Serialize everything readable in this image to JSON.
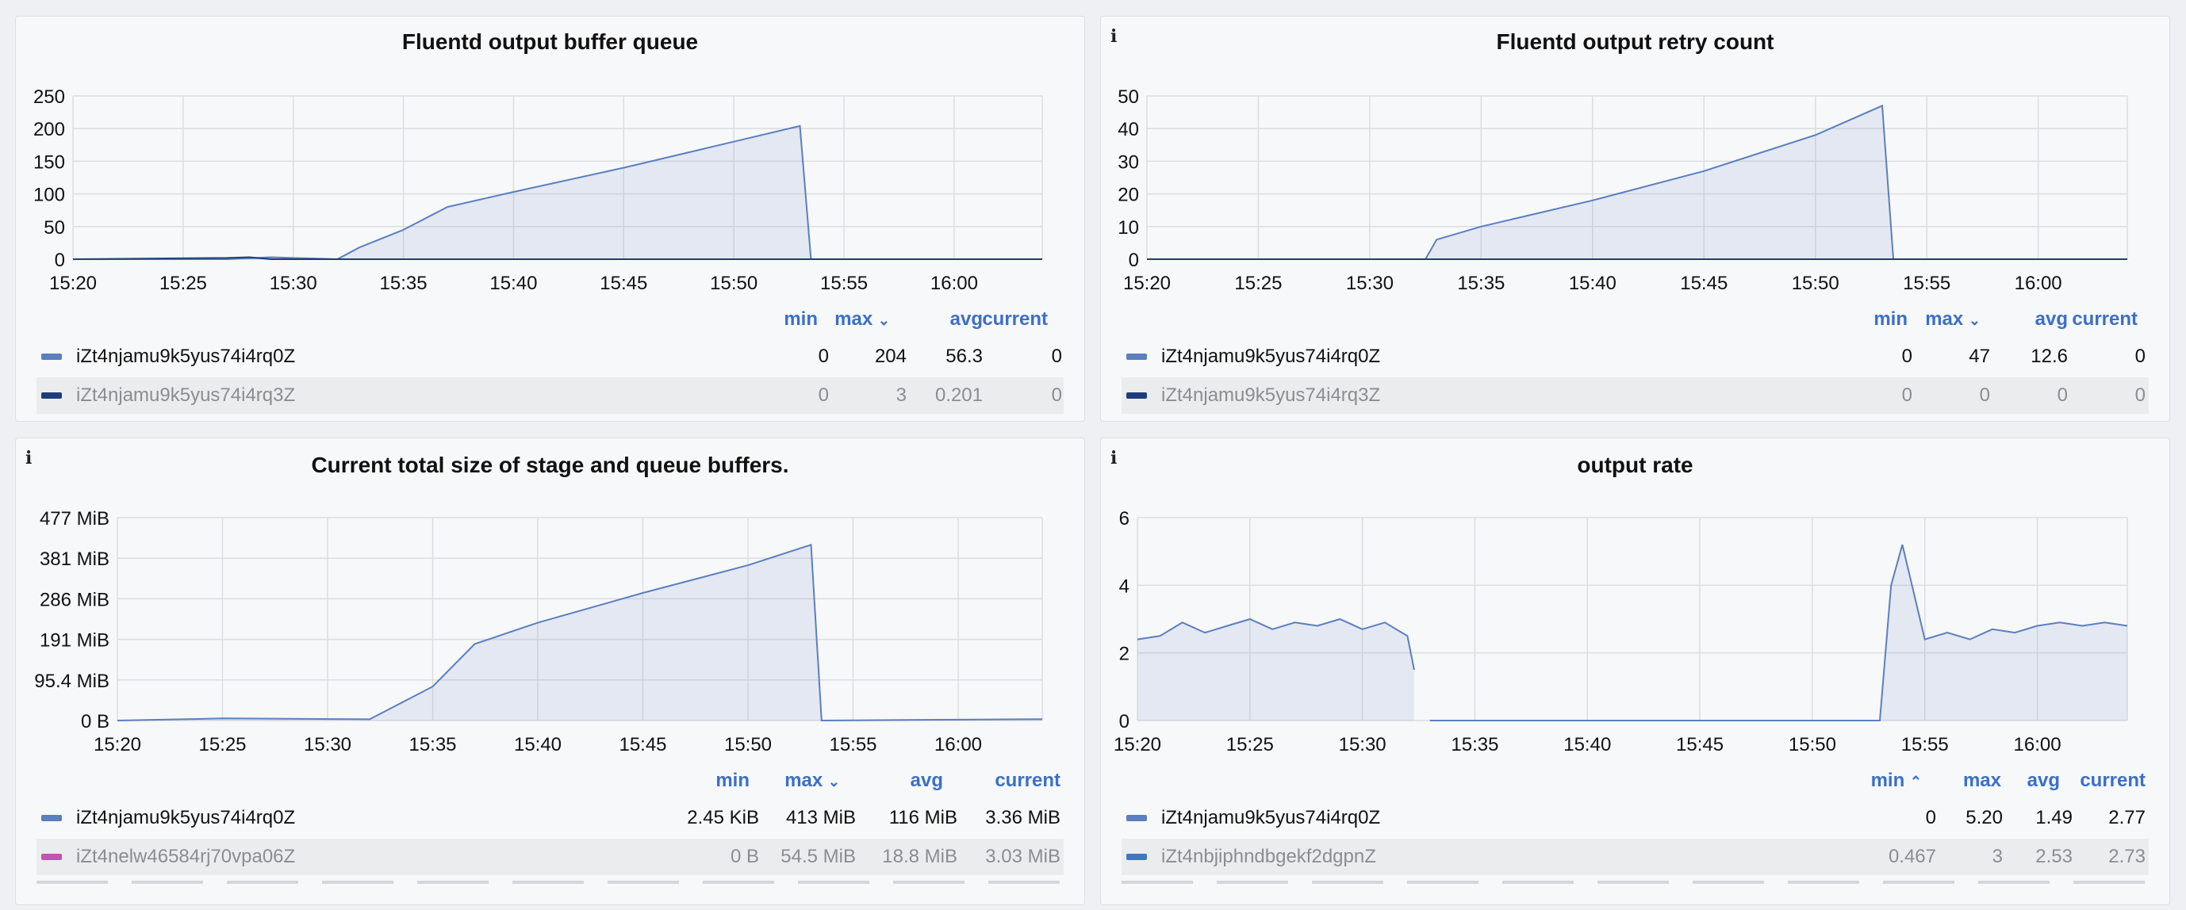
{
  "panels": [
    {
      "id": "p1",
      "title": "Fluentd output buffer queue",
      "show_info": false,
      "ylabels": [
        "250",
        "200",
        "150",
        "100",
        "50",
        "0"
      ],
      "xlabels": [
        "15:20",
        "15:25",
        "15:30",
        "15:35",
        "15:40",
        "15:45",
        "15:50",
        "15:55",
        "16:00"
      ],
      "legend_headers": {
        "min": "min",
        "max": "max",
        "avg": "avg",
        "current": "current",
        "sort": "max",
        "sort_dir": "down"
      },
      "legend": [
        {
          "name": "iZt4njamu9k5yus74i4rq0Z",
          "min": "0",
          "max": "204",
          "avg": "56.3",
          "current": "0",
          "color": "#5b7fbf"
        },
        {
          "name": "iZt4njamu9k5yus74i4rq3Z",
          "min": "0",
          "max": "3",
          "avg": "0.201",
          "current": "0",
          "color": "#1f3d7a"
        }
      ]
    },
    {
      "id": "p2",
      "title": "Fluentd output retry count",
      "show_info": true,
      "ylabels": [
        "50",
        "40",
        "30",
        "20",
        "10",
        "0"
      ],
      "xlabels": [
        "15:20",
        "15:25",
        "15:30",
        "15:35",
        "15:40",
        "15:45",
        "15:50",
        "15:55",
        "16:00"
      ],
      "legend_headers": {
        "min": "min",
        "max": "max",
        "avg": "avg",
        "current": "current",
        "sort": "max",
        "sort_dir": "down"
      },
      "legend": [
        {
          "name": "iZt4njamu9k5yus74i4rq0Z",
          "min": "0",
          "max": "47",
          "avg": "12.6",
          "current": "0",
          "color": "#5b7fbf"
        },
        {
          "name": "iZt4njamu9k5yus74i4rq3Z",
          "min": "0",
          "max": "0",
          "avg": "0",
          "current": "0",
          "color": "#1f3d7a"
        }
      ]
    },
    {
      "id": "p3",
      "title": "Current total size of stage and queue buffers.",
      "show_info": true,
      "ylabels": [
        "477 MiB",
        "381 MiB",
        "286 MiB",
        "191 MiB",
        "95.4 MiB",
        "0 B"
      ],
      "xlabels": [
        "15:20",
        "15:25",
        "15:30",
        "15:35",
        "15:40",
        "15:45",
        "15:50",
        "15:55",
        "16:00"
      ],
      "legend_headers": {
        "min": "min",
        "max": "max",
        "avg": "avg",
        "current": "current",
        "sort": "max",
        "sort_dir": "down"
      },
      "legend": [
        {
          "name": "iZt4njamu9k5yus74i4rq0Z",
          "min": "2.45 KiB",
          "max": "413 MiB",
          "avg": "116 MiB",
          "current": "3.36 MiB",
          "color": "#5b7fbf"
        },
        {
          "name": "iZt4nelw46584rj70vpa06Z",
          "min": "0 B",
          "max": "54.5 MiB",
          "avg": "18.8 MiB",
          "current": "3.03 MiB",
          "color": "#c054b0"
        }
      ]
    },
    {
      "id": "p4",
      "title": "output rate",
      "show_info": true,
      "ylabels": [
        "6",
        "4",
        "2",
        "0"
      ],
      "xlabels": [
        "15:20",
        "15:25",
        "15:30",
        "15:35",
        "15:40",
        "15:45",
        "15:50",
        "15:55",
        "16:00"
      ],
      "legend_headers": {
        "min": "min",
        "max": "max",
        "avg": "avg",
        "current": "current",
        "sort": "min",
        "sort_dir": "up"
      },
      "legend": [
        {
          "name": "iZt4njamu9k5yus74i4rq0Z",
          "min": "0",
          "max": "5.20",
          "avg": "1.49",
          "current": "2.77",
          "color": "#5b7fbf"
        },
        {
          "name": "iZt4nbjiphndbgekf2dgpnZ",
          "min": "0.467",
          "max": "3",
          "avg": "2.53",
          "current": "2.73",
          "color": "#3f78c0"
        }
      ]
    }
  ],
  "chart_data": [
    {
      "type": "area",
      "title": "Fluentd output buffer queue",
      "x_unit": "time",
      "ylim": [
        0,
        250
      ],
      "series": [
        {
          "name": "iZt4njamu9k5yus74i4rq0Z",
          "x": [
            "15:20",
            "15:27",
            "15:29",
            "15:32",
            "15:33",
            "15:35",
            "15:37",
            "15:40",
            "15:45",
            "15:50",
            "15:53",
            "15:53.5",
            "16:04"
          ],
          "values": [
            0,
            0,
            3,
            0,
            18,
            45,
            80,
            103,
            140,
            180,
            204,
            0,
            0
          ]
        },
        {
          "name": "iZt4njamu9k5yus74i4rq3Z",
          "x": [
            "15:20",
            "15:27",
            "15:28",
            "15:29",
            "16:04"
          ],
          "values": [
            0,
            2,
            3,
            0,
            0
          ]
        }
      ]
    },
    {
      "type": "area",
      "title": "Fluentd output retry count",
      "x_unit": "time",
      "ylim": [
        0,
        50
      ],
      "series": [
        {
          "name": "iZt4njamu9k5yus74i4rq0Z",
          "x": [
            "15:20",
            "15:32.5",
            "15:33",
            "15:35",
            "15:40",
            "15:45",
            "15:50",
            "15:53",
            "15:53.5",
            "16:04"
          ],
          "values": [
            0,
            0,
            6,
            10,
            18,
            27,
            38,
            47,
            0,
            0
          ]
        },
        {
          "name": "iZt4njamu9k5yus74i4rq3Z",
          "x": [
            "15:20",
            "16:04"
          ],
          "values": [
            0,
            0
          ]
        }
      ]
    },
    {
      "type": "area",
      "title": "Current total size of stage and queue buffers.",
      "y_unit": "MiB",
      "ylim": [
        0,
        477
      ],
      "series": [
        {
          "name": "iZt4njamu9k5yus74i4rq0Z",
          "x": [
            "15:20",
            "15:25",
            "15:32",
            "15:35",
            "15:37",
            "15:40",
            "15:45",
            "15:50",
            "15:53",
            "15:53.5",
            "16:04"
          ],
          "values": [
            0,
            5,
            3,
            80,
            180,
            230,
            300,
            365,
            413,
            0,
            3.36
          ]
        }
      ]
    },
    {
      "type": "line",
      "title": "output rate",
      "ylim": [
        0,
        6
      ],
      "series": [
        {
          "name": "iZt4njamu9k5yus74i4rq0Z",
          "x": [
            "15:20",
            "15:21",
            "15:22",
            "15:23",
            "15:24",
            "15:25",
            "15:26",
            "15:27",
            "15:28",
            "15:29",
            "15:30",
            "15:31",
            "15:32",
            "15:32.3",
            "15:33",
            "15:40",
            "15:45",
            "15:50",
            "15:53",
            "15:53.5",
            "15:54",
            "15:55",
            "15:56",
            "15:57",
            "15:58",
            "15:59",
            "16:00",
            "16:01",
            "16:02",
            "16:03",
            "16:04"
          ],
          "values": [
            2.4,
            2.5,
            2.9,
            2.6,
            2.8,
            3.0,
            2.7,
            2.9,
            2.8,
            3.0,
            2.7,
            2.9,
            2.5,
            1.5,
            0,
            0,
            0,
            0,
            0,
            4.0,
            5.2,
            2.4,
            2.6,
            2.4,
            2.7,
            2.6,
            2.8,
            2.9,
            2.8,
            2.9,
            2.8
          ]
        }
      ]
    }
  ]
}
